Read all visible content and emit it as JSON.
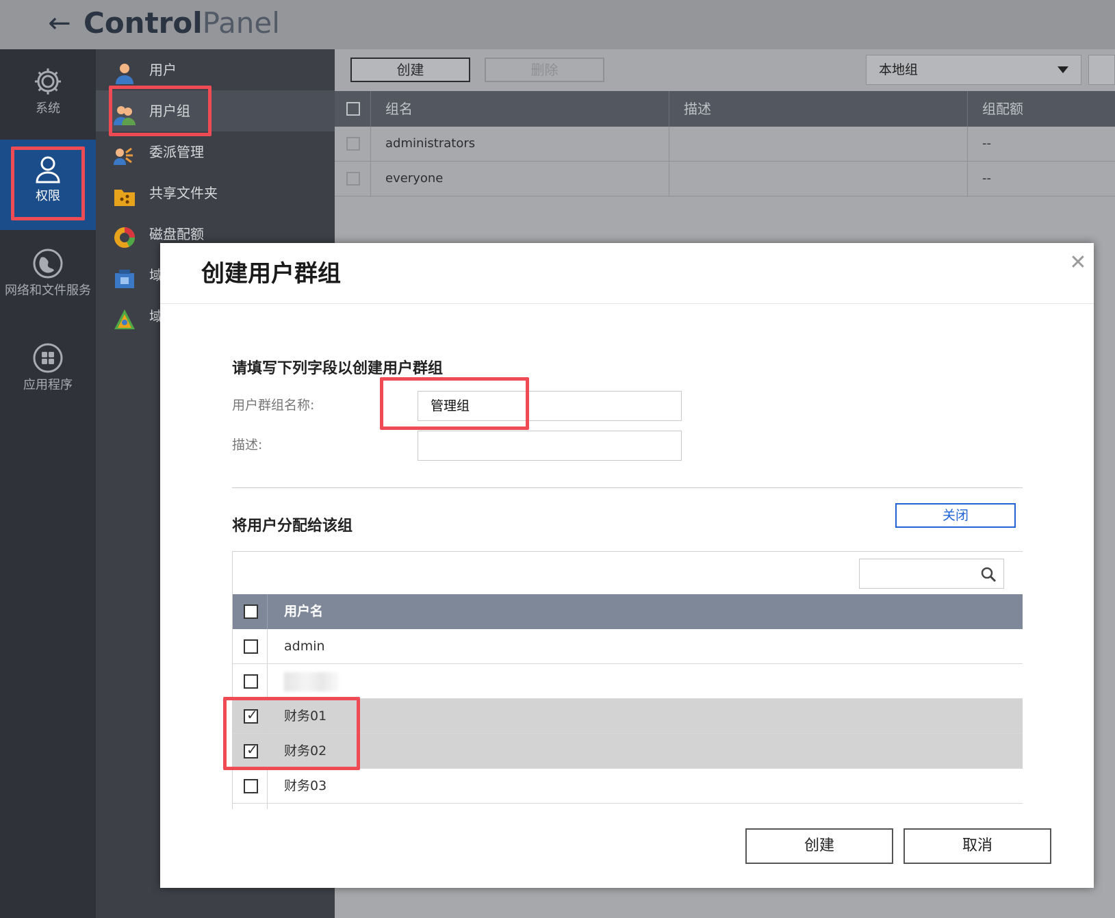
{
  "header": {
    "title_bold": "Control",
    "title_light": "Panel",
    "back_icon": "arrow-left-icon"
  },
  "left_nav": {
    "items": [
      {
        "label": "系统",
        "icon": "gear-icon",
        "active": false
      },
      {
        "label": "权限",
        "icon": "user-icon",
        "active": true
      },
      {
        "label": "网络和文件服务",
        "icon": "globe-icon",
        "active": false
      },
      {
        "label": "应用程序",
        "icon": "apps-grid-icon",
        "active": false
      }
    ]
  },
  "sub_nav": {
    "items": [
      {
        "label": "用户",
        "icon": "user-icon"
      },
      {
        "label": "用户组",
        "icon": "user-group-icon",
        "active": true
      },
      {
        "label": "委派管理",
        "icon": "delegation-icon"
      },
      {
        "label": "共享文件夹",
        "icon": "shared-folder-icon"
      },
      {
        "label": "磁盘配额",
        "icon": "disk-quota-icon"
      },
      {
        "label": "域",
        "icon": "domain-security-icon"
      },
      {
        "label": "域",
        "icon": "domain-controller-icon"
      }
    ]
  },
  "toolbar": {
    "create_label": "创建",
    "delete_label": "删除",
    "group_type_selected": "本地组"
  },
  "group_table": {
    "columns": [
      "组名",
      "描述",
      "组配额"
    ],
    "rows": [
      {
        "name": "administrators",
        "description": "",
        "quota": "--"
      },
      {
        "name": "everyone",
        "description": "",
        "quota": "--"
      }
    ]
  },
  "dialog": {
    "title": "创建用户群组",
    "section1_heading": "请填写下列字段以创建用户群组",
    "name_label": "用户群组名称:",
    "name_value": "管理组",
    "desc_label": "描述:",
    "desc_value": "",
    "section2_heading": "将用户分配给该组",
    "close_section_label": "关闭",
    "search_placeholder": "",
    "user_table": {
      "column": "用户名",
      "rows": [
        {
          "name": "admin",
          "checked": false
        },
        {
          "name": "",
          "checked": false
        },
        {
          "name": "财务01",
          "checked": true
        },
        {
          "name": "财务02",
          "checked": true
        },
        {
          "name": "财务03",
          "checked": false
        }
      ]
    },
    "create_label": "创建",
    "cancel_label": "取消"
  },
  "colors": {
    "highlight": "#ef4b55",
    "accent_blue": "#1f63d6",
    "nav_active": "#1c4d8b",
    "table_header": "#7f8899"
  }
}
